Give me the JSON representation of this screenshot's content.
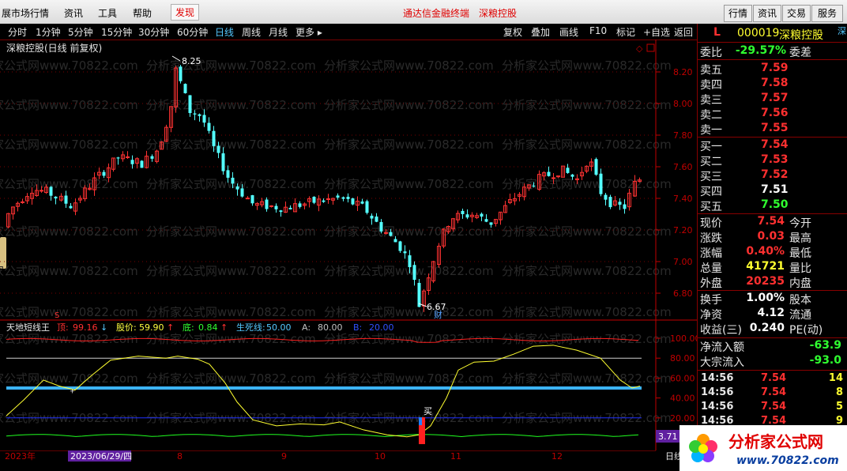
{
  "menubar": {
    "items": [
      "展市场行情",
      "资讯",
      "工具",
      "帮助",
      "发现"
    ],
    "center_links": [
      "通达信金融终端",
      "深粮控股"
    ],
    "right_buttons": [
      "行情",
      "资讯",
      "交易",
      "服务"
    ]
  },
  "periodbar": {
    "tabs": [
      "分时",
      "1分钟",
      "5分钟",
      "15分钟",
      "30分钟",
      "60分钟",
      "日线",
      "周线",
      "月线",
      "更多 ▸"
    ],
    "active": "日线",
    "right_tabs": [
      "复权",
      "叠加",
      "画线",
      "F10",
      "标记",
      "+自选",
      "返回"
    ]
  },
  "chart": {
    "title": "深粮控股(日线 前复权)",
    "high_label": "8.25",
    "low_label": "6.67",
    "fin_marker": "财",
    "s_marker": "S",
    "price_ticks": [
      "8.20",
      "8.00",
      "7.80",
      "7.60",
      "7.40",
      "7.20",
      "7.00",
      "6.80"
    ],
    "watermark": "分析家公式网www.70822.com",
    "colors": {
      "up": "#ff3232",
      "down": "#54ffff",
      "axis": "#c00000",
      "grid": "#7a0000"
    }
  },
  "indicator": {
    "name": "天地短线王",
    "items": [
      {
        "label": "顶:",
        "value": "99.16",
        "arrow": "↓",
        "color": "#ff3030",
        "arrow_color": "#55c8ff"
      },
      {
        "label": "股价:",
        "value": "59.90",
        "arrow": "↑",
        "color": "#ffff40",
        "arrow_color": "#ff3030"
      },
      {
        "label": "底:",
        "value": "0.84",
        "arrow": "↑",
        "color": "#30ff30",
        "arrow_color": "#ff3030"
      },
      {
        "label": "生死线:",
        "value": "50.00",
        "arrow": "",
        "color": "#55c8ff",
        "arrow_color": ""
      },
      {
        "label": "A:",
        "value": "80.00",
        "arrow": "",
        "color": "#c0c0c0",
        "arrow_color": ""
      },
      {
        "label": "B:",
        "value": "20.00",
        "arrow": "",
        "color": "#3050ff",
        "arrow_color": ""
      }
    ],
    "y_ticks": [
      "100.00",
      "80.00",
      "60.00",
      "40.00",
      "20.00"
    ],
    "buy_label": "买",
    "side_value": "3.71"
  },
  "timeline": {
    "labels": [
      "2023年",
      "2023/06/29/四",
      "8",
      "9",
      "10",
      "11",
      "12"
    ],
    "corner": "日线"
  },
  "quote": {
    "header_letter": "L",
    "code": "000019",
    "name": "深粮控股",
    "market": "深",
    "weibi_label": "委比",
    "weibi_value": "-29.57%",
    "weicha_label": "委差",
    "asks": [
      {
        "label": "卖五",
        "price": "7.59"
      },
      {
        "label": "卖四",
        "price": "7.58"
      },
      {
        "label": "卖三",
        "price": "7.57"
      },
      {
        "label": "卖二",
        "price": "7.56"
      },
      {
        "label": "卖一",
        "price": "7.55"
      }
    ],
    "bids": [
      {
        "label": "买一",
        "price": "7.54"
      },
      {
        "label": "买二",
        "price": "7.53"
      },
      {
        "label": "买三",
        "price": "7.52"
      },
      {
        "label": "买四",
        "price": "7.51"
      },
      {
        "label": "买五",
        "price": "7.50"
      }
    ],
    "stats": [
      {
        "label": "现价",
        "value": "7.54",
        "label2": "今开",
        "color": "red"
      },
      {
        "label": "涨跌",
        "value": "0.03",
        "label2": "最高",
        "color": "red"
      },
      {
        "label": "涨幅",
        "value": "0.40%",
        "label2": "最低",
        "color": "red"
      },
      {
        "label": "总量",
        "value": "41721",
        "label2": "量比",
        "color": "yellow"
      },
      {
        "label": "外盘",
        "value": "20235",
        "label2": "内盘",
        "color": "red"
      }
    ],
    "stats2": [
      {
        "label": "换手",
        "value": "1.00%",
        "label2": "股本",
        "color": "white"
      },
      {
        "label": "净资",
        "value": "4.12",
        "label2": "流通",
        "color": "white"
      },
      {
        "label": "收益(三)",
        "value": "0.240",
        "label2": "PE(动)",
        "color": "white"
      }
    ],
    "flows": [
      {
        "label": "净流入额",
        "value": "-63.9"
      },
      {
        "label": "大宗流入",
        "value": "-93.0"
      }
    ],
    "trades": [
      {
        "time": "14:56",
        "price": "7.54",
        "vol": "14"
      },
      {
        "time": "14:56",
        "price": "7.54",
        "vol": "8"
      },
      {
        "time": "14:56",
        "price": "7.54",
        "vol": "5"
      },
      {
        "time": "14:56",
        "price": "7.54",
        "vol": "9"
      }
    ]
  },
  "logo": {
    "text": "分析家公式网",
    "url": "www.70822.com"
  }
}
